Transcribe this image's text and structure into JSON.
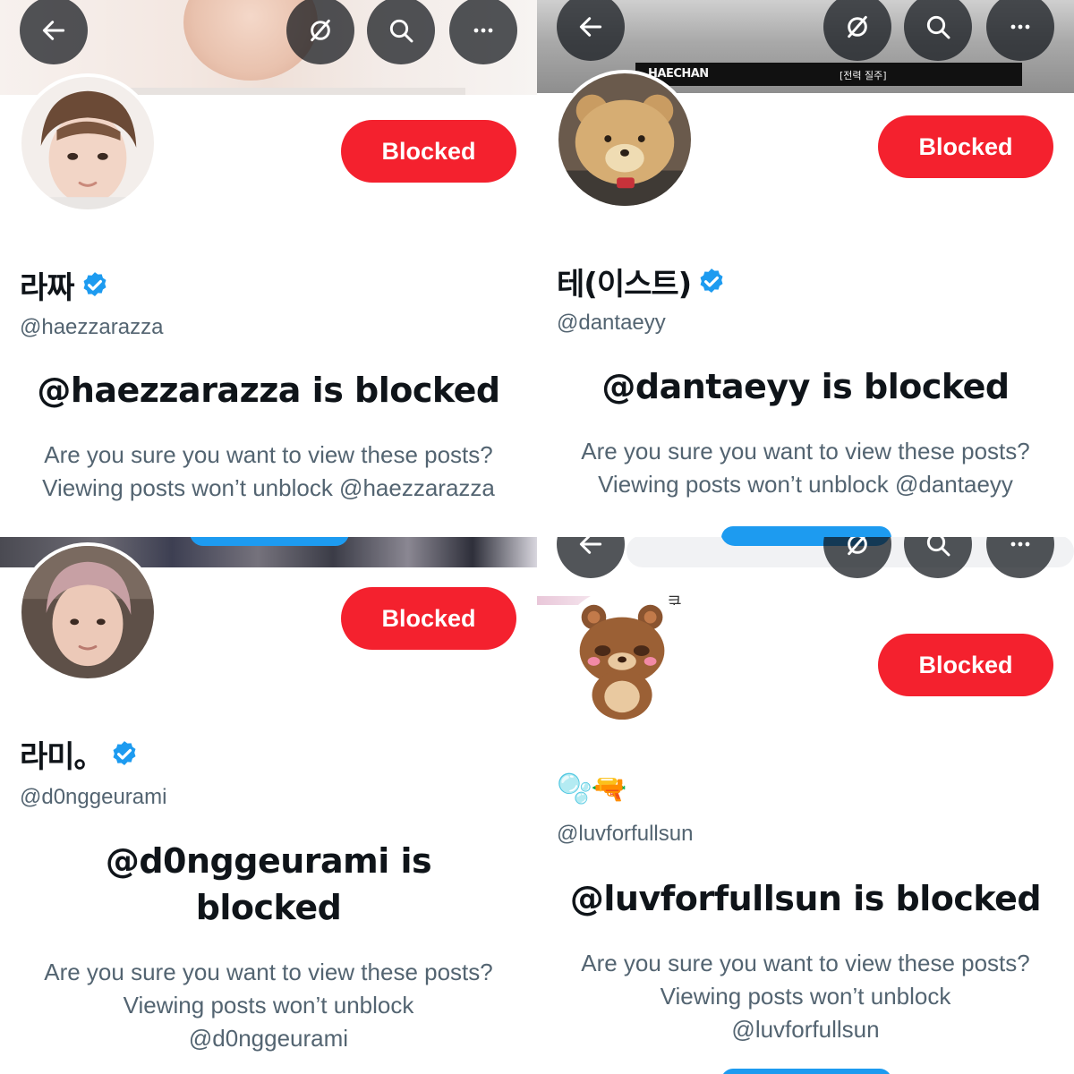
{
  "colors": {
    "blocked_button_bg": "#f4212e",
    "verified_badge": "#1d9bf0",
    "secondary_text": "#536471",
    "primary_text": "#0f1419"
  },
  "panels": [
    {
      "display_name": "라짜",
      "verified": true,
      "handle": "@haezzarazza",
      "blocked_button_label": "Blocked",
      "blocked_title": "@haezzarazza is blocked",
      "blocked_msg_line1": "Are you sure you want to view these posts?",
      "blocked_msg_line2": "Viewing posts won’t unblock @haezzarazza",
      "icons": [
        "back-arrow-icon",
        "grok-icon",
        "search-icon",
        "more-icon"
      ]
    },
    {
      "banner_caption_left": "HAECHAN",
      "banner_caption_right": "[전력 질주]",
      "display_name": "테(이스트)",
      "verified": true,
      "handle": "@dantaeyy",
      "blocked_button_label": "Blocked",
      "blocked_title": "@dantaeyy is blocked",
      "blocked_msg_line1": "Are you sure you want to view these posts?",
      "blocked_msg_line2": "Viewing posts won’t unblock @dantaeyy",
      "icons": [
        "back-arrow-icon",
        "grok-icon",
        "search-icon",
        "more-icon"
      ]
    },
    {
      "display_name": "라미。",
      "verified": true,
      "handle": "@d0nggeurami",
      "blocked_button_label": "Blocked",
      "blocked_title_line1": "@d0nggeurami is",
      "blocked_title_line2": "blocked",
      "blocked_msg_line1": "Are you sure you want to view these posts?",
      "blocked_msg_line2": "Viewing posts won’t unblock",
      "blocked_msg_line3": "@d0nggeurami"
    },
    {
      "banner_hint": "쿠",
      "display_name": "🫧🔫",
      "verified": false,
      "handle": "@luvforfullsun",
      "blocked_button_label": "Blocked",
      "blocked_title": "@luvforfullsun is blocked",
      "blocked_msg_line1": "Are you sure you want to view these posts?",
      "blocked_msg_line2": "Viewing posts won’t unblock",
      "blocked_msg_line3": "@luvforfullsun",
      "icons": [
        "back-arrow-icon",
        "grok-icon",
        "search-icon",
        "more-icon"
      ]
    }
  ]
}
